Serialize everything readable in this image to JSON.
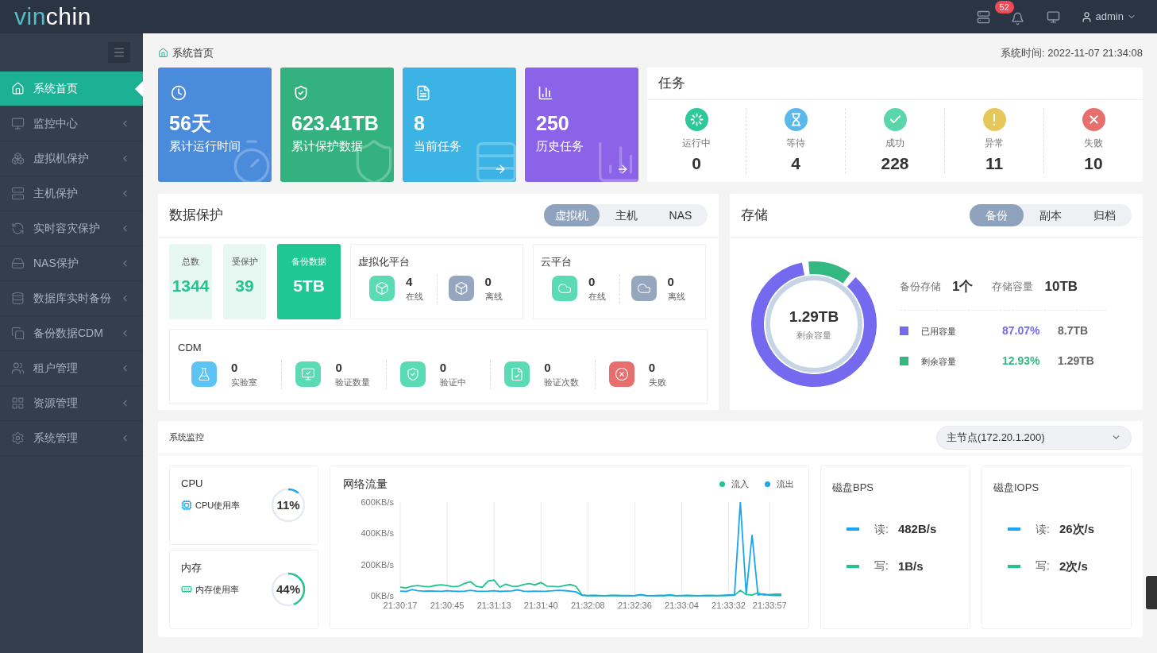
{
  "logo": {
    "accent": "vin",
    "rest": "chin"
  },
  "topbar": {
    "notifications": "52",
    "user": "admin"
  },
  "sidebar": {
    "items": [
      {
        "label": "系统首页",
        "selected": true,
        "submenu": false
      },
      {
        "label": "监控中心",
        "selected": false,
        "submenu": true
      },
      {
        "label": "虚拟机保护",
        "selected": false,
        "submenu": true
      },
      {
        "label": "主机保护",
        "selected": false,
        "submenu": true
      },
      {
        "label": "实时容灾保护",
        "selected": false,
        "submenu": true
      },
      {
        "label": "NAS保护",
        "selected": false,
        "submenu": true
      },
      {
        "label": "数据库实时备份",
        "selected": false,
        "submenu": true
      },
      {
        "label": "备份数据CDM",
        "selected": false,
        "submenu": true
      },
      {
        "label": "租户管理",
        "selected": false,
        "submenu": true
      },
      {
        "label": "资源管理",
        "selected": false,
        "submenu": true
      },
      {
        "label": "系统管理",
        "selected": false,
        "submenu": true
      }
    ]
  },
  "breadcrumb": "系统首页",
  "system_time": "系统时间: 2022-11-07 21:34:08",
  "stat_cards": [
    {
      "value": "56天",
      "label": "累计运行时间",
      "color": "#4a8bdb",
      "arrow": false
    },
    {
      "value": "623.41TB",
      "label": "累计保护数据",
      "color": "#33b17f",
      "arrow": false
    },
    {
      "value": "8",
      "label": "当前任务",
      "color": "#3bb4e5",
      "arrow": true
    },
    {
      "value": "250",
      "label": "历史任务",
      "color": "#8b63e8",
      "arrow": true
    }
  ],
  "tasks": {
    "title": "任务",
    "items": [
      {
        "kind": "running",
        "label": "运行中",
        "count": "0",
        "color": "#2ec99a"
      },
      {
        "kind": "waiting",
        "label": "等待",
        "count": "4",
        "color": "#5ab9ea"
      },
      {
        "kind": "success",
        "label": "成功",
        "count": "228",
        "color": "#5ad6aa"
      },
      {
        "kind": "warning",
        "label": "异常",
        "count": "11",
        "color": "#e6c85a"
      },
      {
        "kind": "failed",
        "label": "失败",
        "count": "10",
        "color": "#e86e6e"
      }
    ]
  },
  "data_protection": {
    "title": "数据保护",
    "tabs": [
      {
        "label": "虚拟机",
        "selected": true
      },
      {
        "label": "主机",
        "selected": false
      },
      {
        "label": "NAS",
        "selected": false
      }
    ],
    "stats": [
      {
        "kind": "plain",
        "label": "总数",
        "value": "1344"
      },
      {
        "kind": "plain",
        "label": "受保护",
        "value": "39"
      },
      {
        "kind": "highlight",
        "label": "备份数据",
        "value": "5TB"
      }
    ],
    "platforms": [
      {
        "title": "虚拟化平台",
        "kind": "virtual",
        "items": [
          {
            "count": "4",
            "label": "在线",
            "color": "#5bdbb4"
          },
          {
            "count": "0",
            "label": "离线",
            "color": "#97a6bf"
          }
        ]
      },
      {
        "title": "云平台",
        "kind": "cloud",
        "items": [
          {
            "count": "0",
            "label": "在线",
            "color": "#5bdbb4"
          },
          {
            "count": "0",
            "label": "离线",
            "color": "#97a6bf"
          }
        ]
      }
    ],
    "cdm": {
      "title": "CDM",
      "items": [
        {
          "count": "0",
          "label": "实验室",
          "color": "#5cc3f5"
        },
        {
          "count": "0",
          "label": "验证数量",
          "color": "#5bdbb4"
        },
        {
          "count": "0",
          "label": "验证中",
          "color": "#5bdbb4"
        },
        {
          "count": "0",
          "label": "验证次数",
          "color": "#5bdbb4"
        },
        {
          "count": "0",
          "label": "失败",
          "color": "#e86e6e"
        }
      ]
    }
  },
  "storage": {
    "title": "存储",
    "tabs": [
      {
        "label": "备份",
        "selected": true
      },
      {
        "label": "副本",
        "selected": false
      },
      {
        "label": "归档",
        "selected": false
      }
    ],
    "center_value": "1.29TB",
    "center_label": "剩余容量",
    "chart_data": {
      "type": "donut",
      "values": [
        87.07,
        12.93
      ]
    },
    "summary": [
      {
        "label": "备份存储",
        "value": "1个"
      },
      {
        "label": "存储容量",
        "value": "10TB"
      }
    ],
    "legend": [
      {
        "label": "已用容量",
        "percent": "87.07%",
        "value": "8.7TB",
        "color": "#7469ef"
      },
      {
        "label": "剩余容量",
        "percent": "12.93%",
        "value": "1.29TB",
        "color": "#34b882"
      }
    ]
  },
  "monitor": {
    "title": "系统监控",
    "node": "主节点(172.20.1.200)",
    "gauges": [
      {
        "title": "CPU",
        "label": "CPU使用率",
        "reading": "11%",
        "level": 0.11,
        "color": "#1ea7f2"
      },
      {
        "title": "内存",
        "label": "内存使用率",
        "reading": "44%",
        "level": 0.44,
        "color": "#22c490"
      }
    ],
    "network": {
      "chart_data": {
        "type": "line",
        "title": "网络流量",
        "grid": true,
        "ylim": [
          0,
          600
        ],
        "categories": [
          "21:30:17",
          null,
          null,
          null,
          null,
          null,
          null,
          null,
          "21:30:45",
          null,
          null,
          null,
          null,
          null,
          null,
          null,
          "21:31:13",
          null,
          null,
          null,
          null,
          null,
          null,
          null,
          "21:31:40",
          null,
          null,
          null,
          null,
          null,
          null,
          null,
          "21:32:08",
          null,
          null,
          null,
          null,
          null,
          null,
          null,
          "21:32:36",
          null,
          null,
          null,
          null,
          null,
          null,
          null,
          "21:33:04",
          null,
          null,
          null,
          null,
          null,
          null,
          null,
          "21:33:32",
          null,
          null,
          null,
          null,
          null,
          null,
          "21:33:57",
          null,
          null
        ],
        "yticks": [
          {
            "value": 0,
            "label": "0KB/s"
          },
          {
            "value": 200,
            "label": "200KB/s"
          },
          {
            "value": 400,
            "label": "400KB/s"
          },
          {
            "value": 600,
            "label": "600KB/s"
          }
        ],
        "series": [
          {
            "name": "流入",
            "color": "#21c48f",
            "values": [
              55,
              50,
              62,
              65,
              60,
              58,
              66,
              70,
              65,
              58,
              62,
              80,
              90,
              60,
              55,
              95,
              100,
              55,
              75,
              62,
              60,
              72,
              78,
              70,
              85,
              62,
              60,
              58,
              65,
              72,
              60,
              5,
              2,
              3,
              2,
              1,
              2,
              3,
              2,
              1,
              2,
              5,
              2,
              1,
              2,
              3,
              2,
              1,
              2,
              3,
              2,
              1,
              2,
              3,
              2,
              1,
              2,
              3,
              35,
              8,
              5,
              20,
              5,
              8,
              10,
              10
            ]
          },
          {
            "name": "流出",
            "color": "#19a6f0",
            "values": [
              30,
              28,
              40,
              32,
              30,
              31,
              30,
              29,
              32,
              30,
              28,
              30,
              35,
              30,
              29,
              30,
              32,
              28,
              30,
              31,
              38,
              30,
              28,
              30,
              29,
              30,
              32,
              35,
              33,
              30,
              25,
              3,
              1,
              2,
              1,
              1,
              3,
              1,
              1,
              2,
              1,
              8,
              1,
              1,
              2,
              1,
              7,
              1,
              1,
              2,
              1,
              1,
              2,
              1,
              1,
              3,
              5,
              5,
              600,
              10,
              390,
              5,
              12,
              3,
              2,
              2
            ]
          }
        ]
      }
    },
    "disks": [
      {
        "title": "磁盘BPS",
        "rows": [
          {
            "label": "读:",
            "value": "482B/s",
            "color": "#19a6f0"
          },
          {
            "label": "写:",
            "value": "1B/s",
            "color": "#21c48f"
          }
        ]
      },
      {
        "title": "磁盘IOPS",
        "rows": [
          {
            "label": "读:",
            "value": "26次/s",
            "color": "#19a6f0"
          },
          {
            "label": "写:",
            "value": "2次/s",
            "color": "#21c48f"
          }
        ]
      }
    ]
  }
}
